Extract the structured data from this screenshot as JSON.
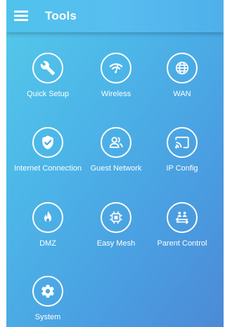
{
  "header": {
    "title": "Tools"
  },
  "tiles": [
    {
      "label": "Quick Setup",
      "icon": "wrench-icon"
    },
    {
      "label": "Wireless",
      "icon": "wifi-icon"
    },
    {
      "label": "WAN",
      "icon": "globe-icon"
    },
    {
      "label": "Internet Connection",
      "icon": "shield-check-icon"
    },
    {
      "label": "Guest Network",
      "icon": "guests-icon"
    },
    {
      "label": "IP Config",
      "icon": "cast-icon"
    },
    {
      "label": "DMZ",
      "icon": "flame-icon"
    },
    {
      "label": "Easy Mesh",
      "icon": "chip-icon"
    },
    {
      "label": "Parent Control",
      "icon": "parental-icon"
    },
    {
      "label": "System",
      "icon": "gear-icon"
    }
  ],
  "colors": {
    "background_start": "#55c9ea",
    "background_end": "#4c8ad6",
    "foreground": "#ffffff"
  }
}
